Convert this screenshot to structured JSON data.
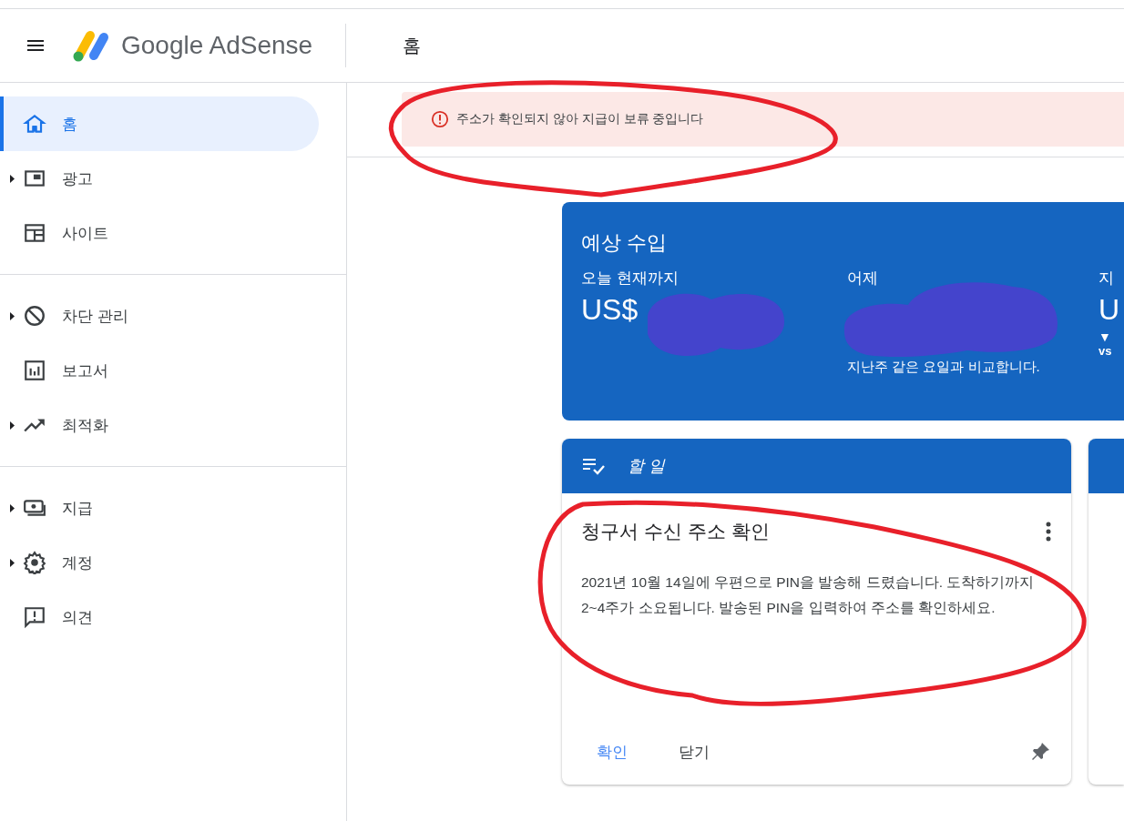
{
  "header": {
    "product": "Google AdSense",
    "page_title": "홈"
  },
  "sidebar": {
    "sections": [
      {
        "items": [
          {
            "label": "홈",
            "expandable": false,
            "selected": true
          },
          {
            "label": "광고",
            "expandable": true,
            "selected": false
          },
          {
            "label": "사이트",
            "expandable": false,
            "selected": false
          }
        ]
      },
      {
        "items": [
          {
            "label": "차단 관리",
            "expandable": true,
            "selected": false
          },
          {
            "label": "보고서",
            "expandable": false,
            "selected": false
          },
          {
            "label": "최적화",
            "expandable": true,
            "selected": false
          }
        ]
      },
      {
        "items": [
          {
            "label": "지급",
            "expandable": true,
            "selected": false
          },
          {
            "label": "계정",
            "expandable": true,
            "selected": false
          },
          {
            "label": "의견",
            "expandable": false,
            "selected": false
          }
        ]
      }
    ]
  },
  "alert": {
    "text": "주소가 확인되지 않아 지급이 보류 중입니다"
  },
  "earnings_card": {
    "title": "예상 수입",
    "columns": [
      {
        "label": "오늘 현재까지",
        "value": "US$"
      },
      {
        "label": "어제",
        "note": "지난주 같은 요일과 비교합니다."
      },
      {
        "label": "지",
        "value": "U",
        "trend": "▼",
        "comparison": "vs"
      }
    ]
  },
  "todo_card": {
    "header": "할 일",
    "title": "청구서 수신 주소 확인",
    "body": "2021년 10월 14일에 우편으로 PIN을 발송해 드렸습니다. 도착하기까지 2~4주가 소요됩니다. 발송된 PIN을 입력하여 주소를 확인하세요.",
    "actions": [
      {
        "label": "확인",
        "kind": "primary"
      },
      {
        "label": "닫기",
        "kind": "secondary"
      }
    ]
  }
}
